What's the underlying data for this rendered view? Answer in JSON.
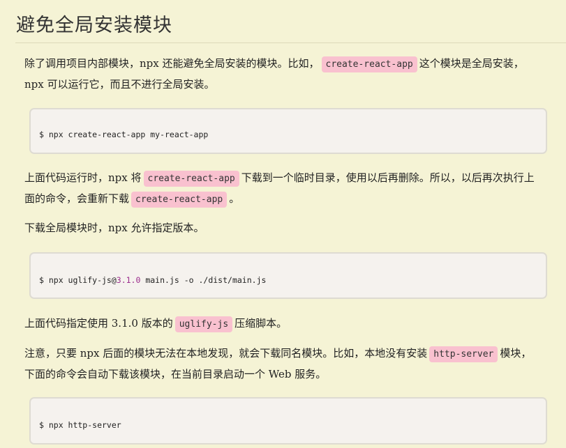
{
  "heading": "避免全局安装模块",
  "p1": {
    "before": "除了调用项目内部模块，npx 还能避免全局安装的模块。比如，",
    "code": "create-react-app",
    "after": "这个模块是全局安装，",
    "line2": "npx 可以运行它，而且不进行全局安装。"
  },
  "code1": "$ npx create-react-app my-react-app",
  "p2": {
    "before": "上面代码运行时，npx 将",
    "code1": "create-react-app",
    "middle": "下载到一个临时目录，使用以后再删除。所以，以后再次执行上",
    "line2_before": "面的命令，会重新下载",
    "code2": "create-react-app",
    "line2_after": "。"
  },
  "p3": "下载全局模块时，npx 允许指定版本。",
  "code2": {
    "before": "$ npx uglify-js@",
    "version": "3.1.0",
    "after": " main.js -o ./dist/main.js"
  },
  "p4": {
    "before": "上面代码指定使用 3.1.0 版本的",
    "code": "uglify-js",
    "after": "压缩脚本。"
  },
  "p5": {
    "before": "注意，只要 npx 后面的模块无法在本地发现，就会下载同名模块。比如，本地没有安装",
    "code": "http-server",
    "after": "模块，",
    "line2": "下面的命令会自动下载该模块，在当前目录启动一个 Web 服务。"
  },
  "code3": "$ npx http-server"
}
